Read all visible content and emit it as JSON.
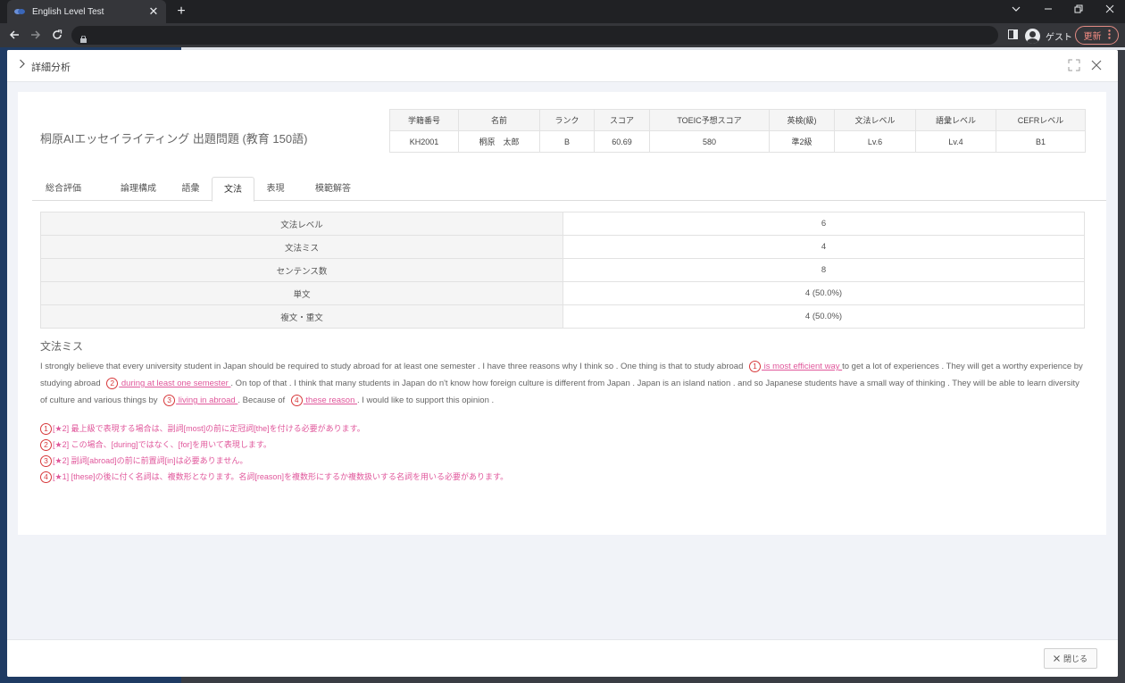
{
  "browser": {
    "tab_title": "English Level Test",
    "tab_close": "✕",
    "new_tab": "+",
    "profile_label": "ゲスト",
    "update_label": "更新"
  },
  "modal": {
    "title": "詳細分析",
    "close_label": "閉じる"
  },
  "problem_title": "桐原AIエッセイライティング 出題問題 (教育 150語)",
  "student_table": {
    "headers": [
      "学籍番号",
      "名前",
      "ランク",
      "スコア",
      "TOEIC予想スコア",
      "英検(級)",
      "文法レベル",
      "語彙レベル",
      "CEFRレベル"
    ],
    "values": [
      "KH2001",
      "桐原　太郎",
      "B",
      "60.69",
      "580",
      "準2級",
      "Lv.6",
      "Lv.4",
      "B1"
    ]
  },
  "tabs": [
    "総合評価",
    "論理構成",
    "語彙",
    "文法",
    "表現",
    "模範解答"
  ],
  "active_tab": "文法",
  "grammar_table": [
    {
      "label": "文法レベル",
      "value": "6"
    },
    {
      "label": "文法ミス",
      "value": "4"
    },
    {
      "label": "センテンス数",
      "value": "8"
    },
    {
      "label": "単文",
      "value": "4 (50.0%)"
    },
    {
      "label": "複文・重文",
      "value": "4 (50.0%)"
    }
  ],
  "section_title": "文法ミス",
  "essay": {
    "seg1": "I strongly believe that every university student in Japan should be required to study abroad for at least one semester . I have three reasons why I think so . One thing is that to study abroad ",
    "err1": " is most efficient way ",
    "seg2": " to get a lot of experiences . They will get a worthy experience by studying abroad ",
    "err2": " during at least one semester ",
    "seg3": " . On top of that . I think that many students in Japan do n't know how foreign culture is different from Japan . Japan is an island nation . and so Japanese students have a small way of thinking . They will be able to learn diversity of culture and various things by ",
    "err3": " living in abroad ",
    "seg4": " . Because of ",
    "err4": " these reason ",
    "seg5": " . I would like to support this opinion ."
  },
  "markers": [
    "1",
    "2",
    "3",
    "4"
  ],
  "notes": [
    "[★2] 最上級で表現する場合は、副詞[most]の前に定冠詞[the]を付ける必要があります。",
    "[★2] この場合、[during]ではなく、[for]を用いて表現します。",
    "[★2] 副詞[abroad]の前に前置詞[in]は必要ありません。",
    "[★1] [these]の後に付く名詞は、複数形となります。名詞[reason]を複数形にするか複数扱いする名詞を用いる必要があります。"
  ],
  "colors": {
    "error_text": "#e0579b",
    "marker": "#d7383b"
  }
}
